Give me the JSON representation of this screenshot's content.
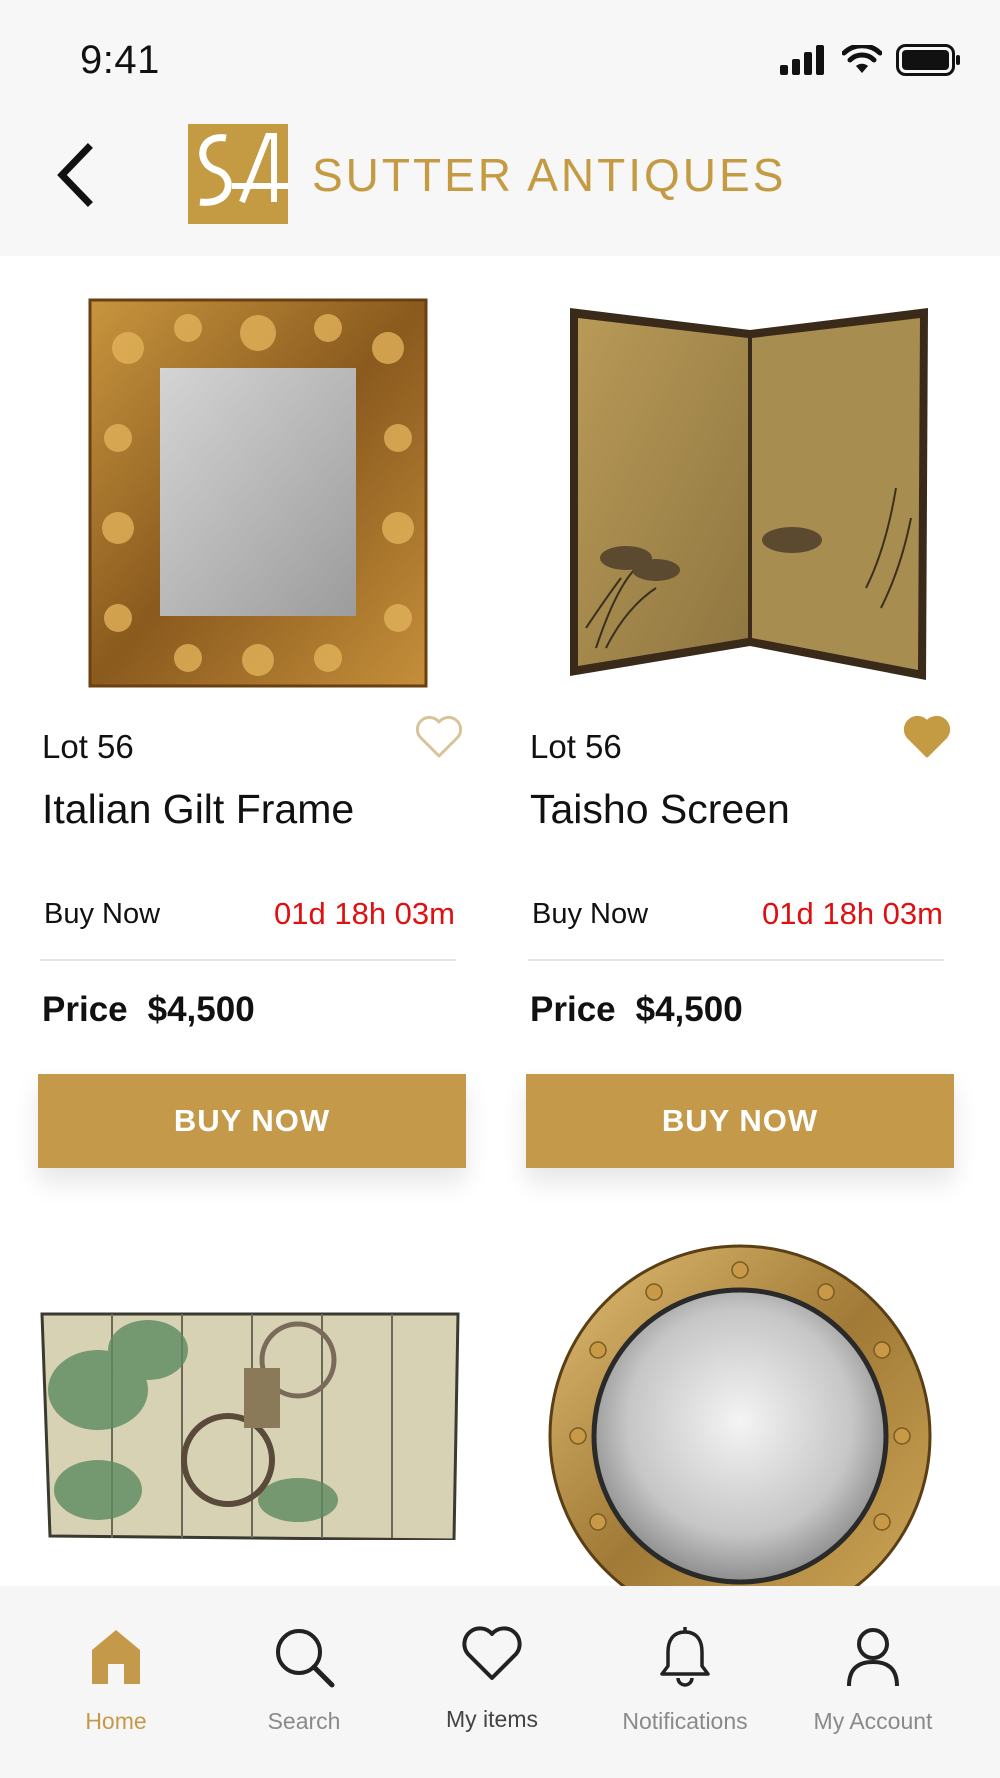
{
  "status_bar": {
    "time": "9:41"
  },
  "header": {
    "brand": "SUTTER ANTIQUES",
    "brand_color": "#c49a42"
  },
  "products": [
    {
      "lot": "Lot 56",
      "name": "Italian Gilt Frame",
      "sale_type": "Buy Now",
      "countdown": "01d 18h 03m",
      "price_label": "Price",
      "price": "$4,500",
      "button": "BUY NOW",
      "favorited": false,
      "image": "gilt-frame-mirror"
    },
    {
      "lot": "Lot 56",
      "name": "Taisho Screen",
      "sale_type": "Buy Now",
      "countdown": "01d 18h 03m",
      "price_label": "Price",
      "price": "$4,500",
      "button": "BUY NOW",
      "favorited": true,
      "image": "two-panel-screen-geese"
    },
    {
      "image": "six-panel-screen-cart"
    },
    {
      "image": "round-convex-mirror"
    }
  ],
  "nav": {
    "items": [
      {
        "label": "Home",
        "icon": "home-icon",
        "active": true
      },
      {
        "label": "Search",
        "icon": "search-icon",
        "active": false
      },
      {
        "label": "My items",
        "icon": "heart-icon",
        "active": false
      },
      {
        "label": "Notifications",
        "icon": "bell-icon",
        "active": false
      },
      {
        "label": "My Account",
        "icon": "user-icon",
        "active": false
      }
    ]
  },
  "colors": {
    "accent": "#c49a4a",
    "timer": "#e01010",
    "active_nav": "#c49a4a"
  }
}
